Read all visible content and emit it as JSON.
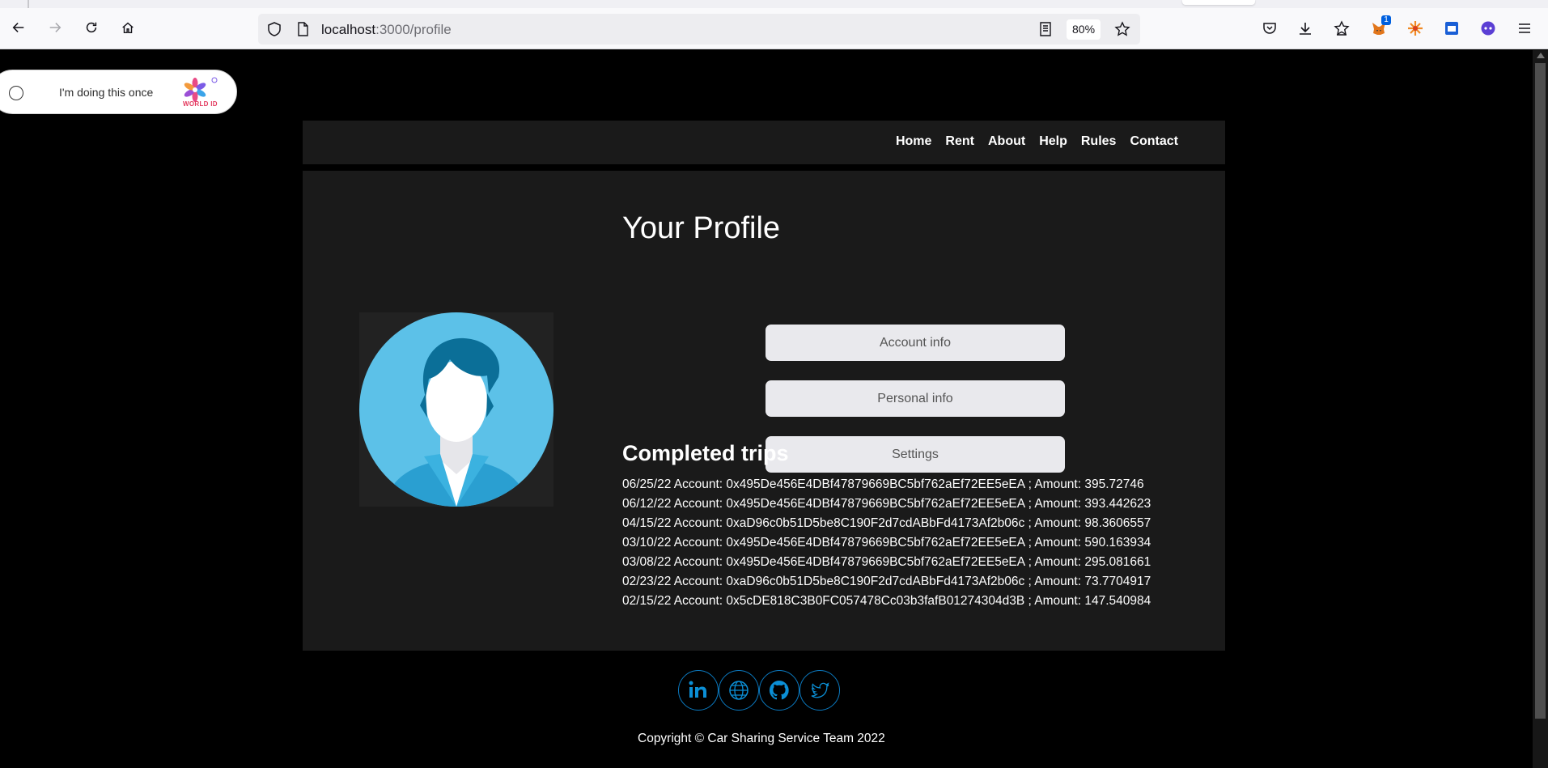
{
  "browser": {
    "url_host": "localhost",
    "url_path": ":3000/profile",
    "zoom": "80%",
    "extension_badge": "1"
  },
  "worldid": {
    "label": "I'm doing this once",
    "logo_text": "WORLD ID"
  },
  "nav": {
    "items": [
      {
        "label": "Home"
      },
      {
        "label": "Rent"
      },
      {
        "label": "About"
      },
      {
        "label": "Help"
      },
      {
        "label": "Rules"
      },
      {
        "label": "Contact"
      }
    ]
  },
  "profile": {
    "title": "Your Profile",
    "buttons": {
      "account": "Account info",
      "personal": "Personal info",
      "settings": "Settings"
    },
    "trips_title": "Completed trips",
    "trips": [
      "06/25/22 Account: 0x495De456E4DBf47879669BC5bf762aEf72EE5eEA ; Amount: 395.72746",
      "06/12/22 Account: 0x495De456E4DBf47879669BC5bf762aEf72EE5eEA ; Amount: 393.442623",
      "04/15/22 Account: 0xaD96c0b51D5be8C190F2d7cdABbFd4173Af2b06c ; Amount: 98.3606557",
      "03/10/22 Account: 0x495De456E4DBf47879669BC5bf762aEf72EE5eEA ; Amount: 590.163934",
      "03/08/22 Account: 0x495De456E4DBf47879669BC5bf762aEf72EE5eEA ; Amount: 295.081661",
      "02/23/22 Account: 0xaD96c0b51D5be8C190F2d7cdABbFd4173Af2b06c ; Amount: 73.7704917",
      "02/15/22 Account: 0x5cDE818C3B0FC057478Cc03b3fafB01274304d3B ; Amount: 147.540984"
    ]
  },
  "footer": {
    "copyright": "Copyright © Car Sharing Service Team 2022"
  },
  "colors": {
    "page_bg": "#000000",
    "panel_bg": "#1a1a1a",
    "button_bg": "#e9e9ed",
    "social_accent": "#0b8fd6"
  }
}
